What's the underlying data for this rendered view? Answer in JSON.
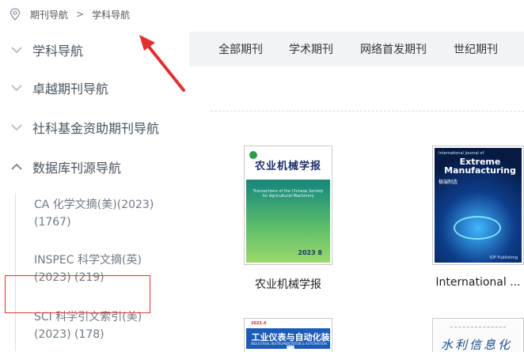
{
  "breadcrumb": {
    "icon": "location-pin-icon",
    "items": [
      "期刊导航",
      "学科导航"
    ],
    "separator": ">"
  },
  "sidebar": {
    "items": [
      {
        "label": "学科导航",
        "state": "collapsed"
      },
      {
        "label": "卓越期刊导航",
        "state": "collapsed"
      },
      {
        "label": "社科基金资助期刊导航",
        "state": "collapsed"
      },
      {
        "label": "数据库刊源导航",
        "state": "expanded"
      }
    ],
    "subitems": [
      {
        "label": "CA 化学文摘(美)(2023) (1767)"
      },
      {
        "label": "INSPEC 科学文摘(英) (2023) (219)"
      },
      {
        "label": "SCI 科学引文索引(美) (2023) (178)"
      }
    ]
  },
  "tabs": [
    {
      "label": "全部期刊"
    },
    {
      "label": "学术期刊"
    },
    {
      "label": "网络首发期刊"
    },
    {
      "label": "世纪期刊"
    }
  ],
  "journals": [
    {
      "title": "农业机械学报",
      "cover": {
        "title": "农业机械学报",
        "subtitle": "Transactions of the Chinese Society for Agricultural Machinery",
        "issue": "2023 8"
      }
    },
    {
      "title": "International ...",
      "cover": {
        "top": "International Journal of",
        "title": "Extreme Manufacturing",
        "cn": "极端制造",
        "footer": "IOP Publishing"
      }
    },
    {
      "title": "",
      "cover": {
        "year": "2023.4",
        "title": "工业仪表与自动化装置",
        "subtitle": "INDUSTRIAL INSTRUMENTATION & AUTOMATION"
      }
    },
    {
      "title": "",
      "cover": {
        "title": "水利信息化"
      }
    }
  ],
  "colors": {
    "sidebar_text": "#4a5560",
    "sub_text": "#6e7a85",
    "tab_bg": "#f2f3f5",
    "annotation_red": "#e03030"
  }
}
